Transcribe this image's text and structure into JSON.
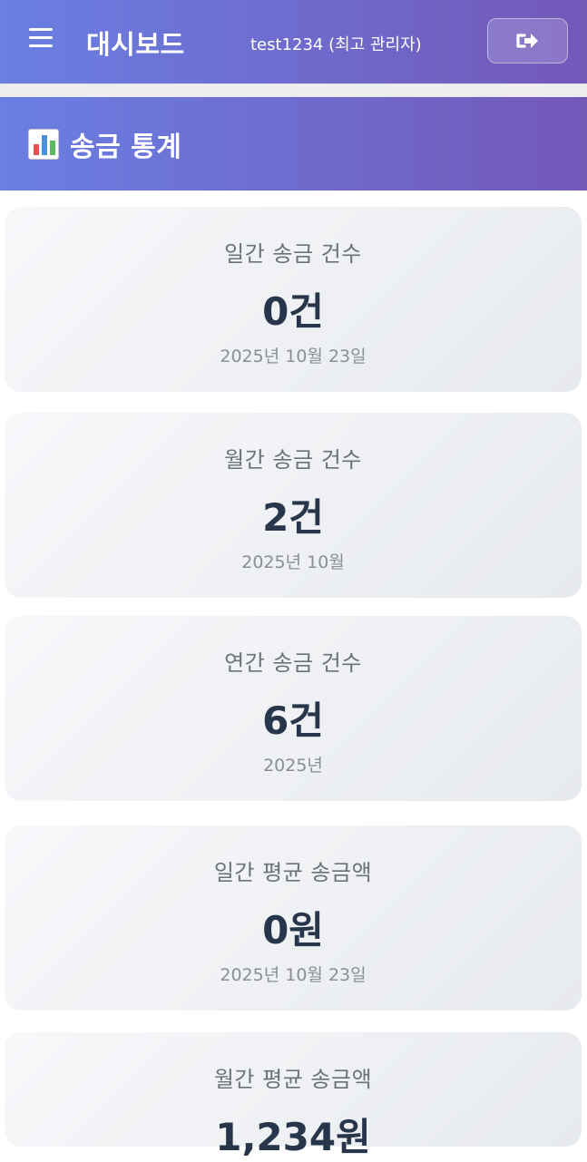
{
  "header": {
    "title": "대시보드",
    "user": "test1234 (최고 관리자)",
    "menu_icon": "hamburger-menu-icon",
    "logout_icon": "sign-out-icon"
  },
  "section": {
    "icon": "bar-chart-icon",
    "title": "송금 통계"
  },
  "stats": [
    {
      "label": "일간 송금 건수",
      "value": "0건",
      "sub": "2025년 10월 23일"
    },
    {
      "label": "월간 송금 건수",
      "value": "2건",
      "sub": "2025년 10월"
    },
    {
      "label": "연간 송금 건수",
      "value": "6건",
      "sub": "2025년"
    },
    {
      "label": "일간 평균 송금액",
      "value": "0원",
      "sub": "2025년 10월 23일"
    },
    {
      "label": "월간 평균 송금액",
      "value": "1,234원",
      "sub": ""
    }
  ],
  "colors": {
    "header_gradient_start": "#6a7fe3",
    "header_gradient_end": "#7358b8",
    "value_text": "#27364a",
    "label_text": "#6c717a"
  }
}
